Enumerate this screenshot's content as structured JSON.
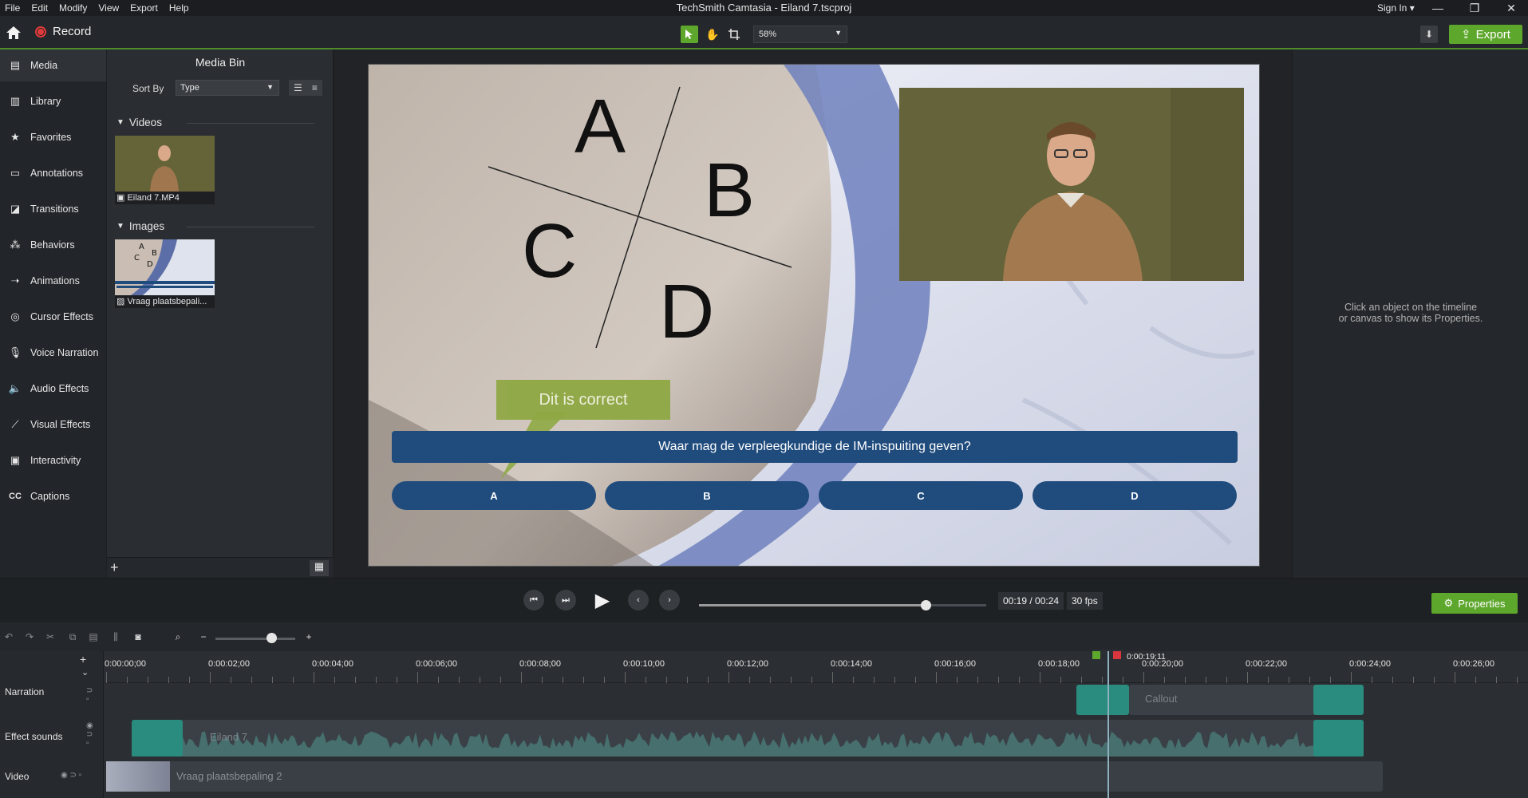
{
  "titlebar": {
    "menu": [
      "File",
      "Edit",
      "Modify",
      "View",
      "Export",
      "Help"
    ],
    "title": "TechSmith Camtasia - Eiland 7.tscproj",
    "signin": "Sign In ▾",
    "minimize": "—",
    "restore": "❐",
    "close": "✕"
  },
  "toolbar": {
    "record_label": "Record",
    "zoom_value": "58%",
    "export_label": "Export"
  },
  "sidebar": {
    "items": [
      {
        "label": "Media",
        "icon": "film-icon",
        "glyph": "▤"
      },
      {
        "label": "Library",
        "icon": "library-icon",
        "glyph": "▥"
      },
      {
        "label": "Favorites",
        "icon": "star-icon",
        "glyph": "★"
      },
      {
        "label": "Annotations",
        "icon": "annotation-icon",
        "glyph": "▭"
      },
      {
        "label": "Transitions",
        "icon": "transition-icon",
        "glyph": "◪"
      },
      {
        "label": "Behaviors",
        "icon": "behavior-icon",
        "glyph": "⁂"
      },
      {
        "label": "Animations",
        "icon": "animation-icon",
        "glyph": "➝"
      },
      {
        "label": "Cursor Effects",
        "icon": "cursor-icon",
        "glyph": "◎"
      },
      {
        "label": "Voice Narration",
        "icon": "microphone-icon",
        "glyph": "🎙"
      },
      {
        "label": "Audio Effects",
        "icon": "speaker-icon",
        "glyph": "🔈"
      },
      {
        "label": "Visual Effects",
        "icon": "wand-icon",
        "glyph": "⟋"
      },
      {
        "label": "Interactivity",
        "icon": "interactivity-icon",
        "glyph": "▣"
      },
      {
        "label": "Captions",
        "icon": "cc-icon",
        "glyph": "CC"
      }
    ]
  },
  "mediabin": {
    "title": "Media Bin",
    "sortby_label": "Sort By",
    "sortby_value": "Type",
    "groups": [
      {
        "label": "Videos",
        "items": [
          {
            "label": "Eiland 7.MP4"
          }
        ]
      },
      {
        "label": "Images",
        "items": [
          {
            "label": "Vraag plaatsbepali..."
          }
        ]
      }
    ],
    "thumb_letters": [
      "A",
      "B",
      "C",
      "D"
    ]
  },
  "canvas": {
    "letters": [
      "A",
      "B",
      "C",
      "D"
    ],
    "callout_text": "Dit is correct",
    "question": "Waar mag de verpleegkundige de IM-inspuiting geven?",
    "answers": [
      "A",
      "B",
      "C",
      "D"
    ],
    "colors": {
      "question_bg": "#1f4b7d",
      "callout_bg": "#8fa844"
    }
  },
  "properties": {
    "hint_line1": "Click an object on the timeline",
    "hint_line2": "or canvas to show its Properties.",
    "button_label": "Properties"
  },
  "transport": {
    "timecode": "00:19 / 00:24",
    "fps": "30 fps",
    "progress": 0.79
  },
  "timeline": {
    "playhead_label": "0:00:19;11",
    "ruler": [
      "0:00:00;00",
      "0:00:02;00",
      "0:00:04;00",
      "0:00:06;00",
      "0:00:08;00",
      "0:00:10;00",
      "0:00:12;00",
      "0:00:14;00",
      "0:00:16;00",
      "0:00:18;00",
      "0:00:20;00",
      "0:00:22;00",
      "0:00:24;00",
      "0:00:26;00"
    ],
    "tracks": [
      {
        "name": "Narration",
        "clip_label": "Callout"
      },
      {
        "name": "Effect sounds",
        "clip_label": "Eiland 7"
      },
      {
        "name": "Video",
        "clip_label": "Vraag plaatsbepaling 2"
      }
    ]
  }
}
